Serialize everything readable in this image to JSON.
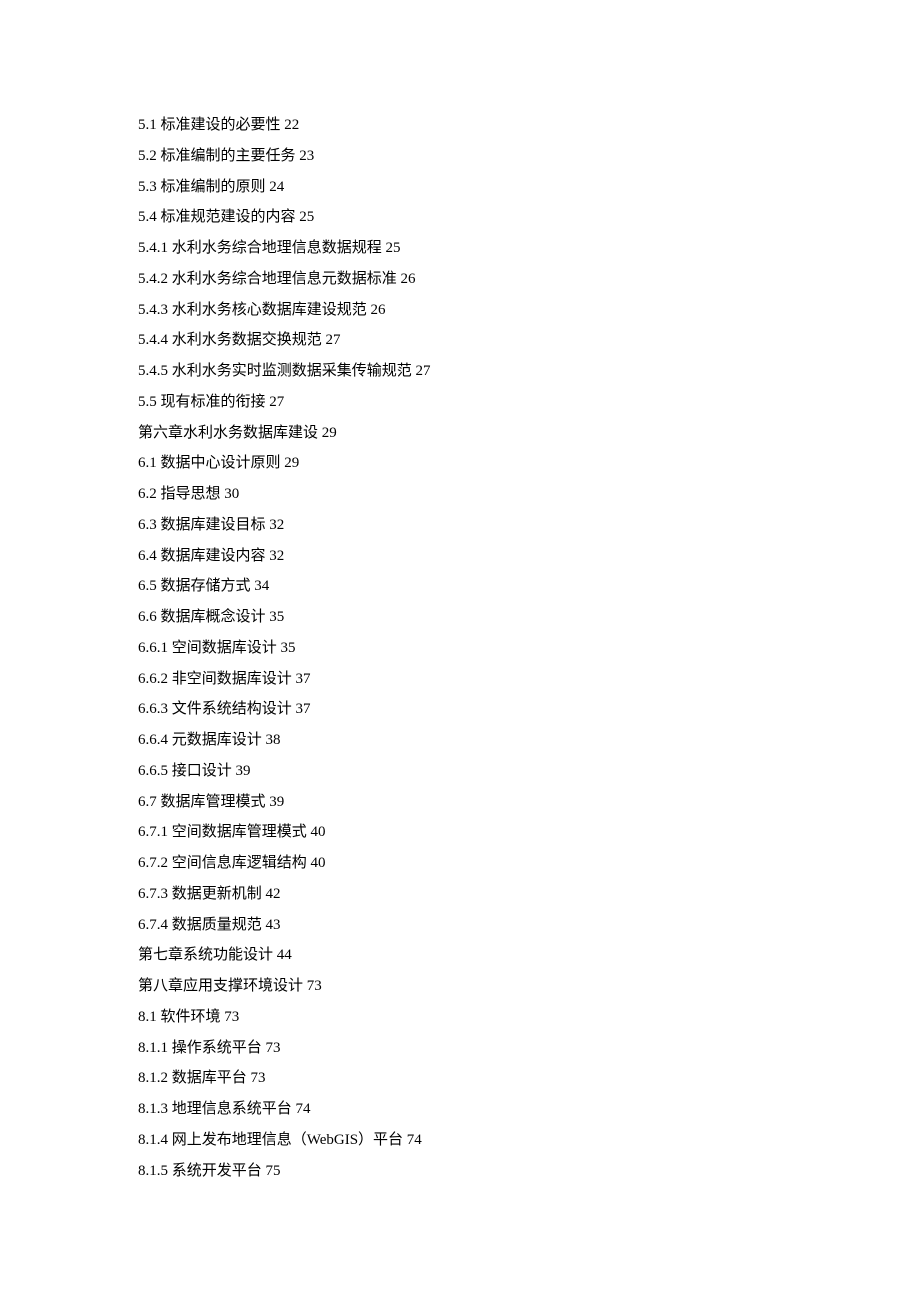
{
  "toc": [
    {
      "label": "5.1 标准建设的必要性 22"
    },
    {
      "label": "5.2 标准编制的主要任务 23"
    },
    {
      "label": "5.3 标准编制的原则 24"
    },
    {
      "label": "5.4 标准规范建设的内容 25"
    },
    {
      "label": "5.4.1 水利水务综合地理信息数据规程 25"
    },
    {
      "label": "5.4.2 水利水务综合地理信息元数据标准 26"
    },
    {
      "label": "5.4.3 水利水务核心数据库建设规范 26"
    },
    {
      "label": "5.4.4 水利水务数据交换规范 27"
    },
    {
      "label": "5.4.5 水利水务实时监测数据采集传输规范 27"
    },
    {
      "label": "5.5 现有标准的衔接 27"
    },
    {
      "label": "第六章水利水务数据库建设 29"
    },
    {
      "label": "6.1 数据中心设计原则 29"
    },
    {
      "label": "6.2 指导思想 30"
    },
    {
      "label": "6.3 数据库建设目标 32"
    },
    {
      "label": "6.4 数据库建设内容 32"
    },
    {
      "label": "6.5 数据存储方式 34"
    },
    {
      "label": "6.6 数据库概念设计 35"
    },
    {
      "label": "6.6.1 空间数据库设计 35"
    },
    {
      "label": "6.6.2 非空间数据库设计 37"
    },
    {
      "label": "6.6.3 文件系统结构设计 37"
    },
    {
      "label": "6.6.4 元数据库设计 38"
    },
    {
      "label": "6.6.5 接口设计 39"
    },
    {
      "label": "6.7 数据库管理模式 39"
    },
    {
      "label": "6.7.1 空间数据库管理模式 40"
    },
    {
      "label": "6.7.2 空间信息库逻辑结构 40"
    },
    {
      "label": "6.7.3 数据更新机制 42"
    },
    {
      "label": "6.7.4 数据质量规范 43"
    },
    {
      "label": "第七章系统功能设计 44"
    },
    {
      "label": "第八章应用支撑环境设计 73"
    },
    {
      "label": "8.1 软件环境 73"
    },
    {
      "label": "8.1.1 操作系统平台 73"
    },
    {
      "label": "8.1.2 数据库平台 73"
    },
    {
      "label": "8.1.3 地理信息系统平台 74"
    },
    {
      "label": "8.1.4 网上发布地理信息（WebGIS）平台 74"
    },
    {
      "label": "8.1.5 系统开发平台 75"
    }
  ]
}
